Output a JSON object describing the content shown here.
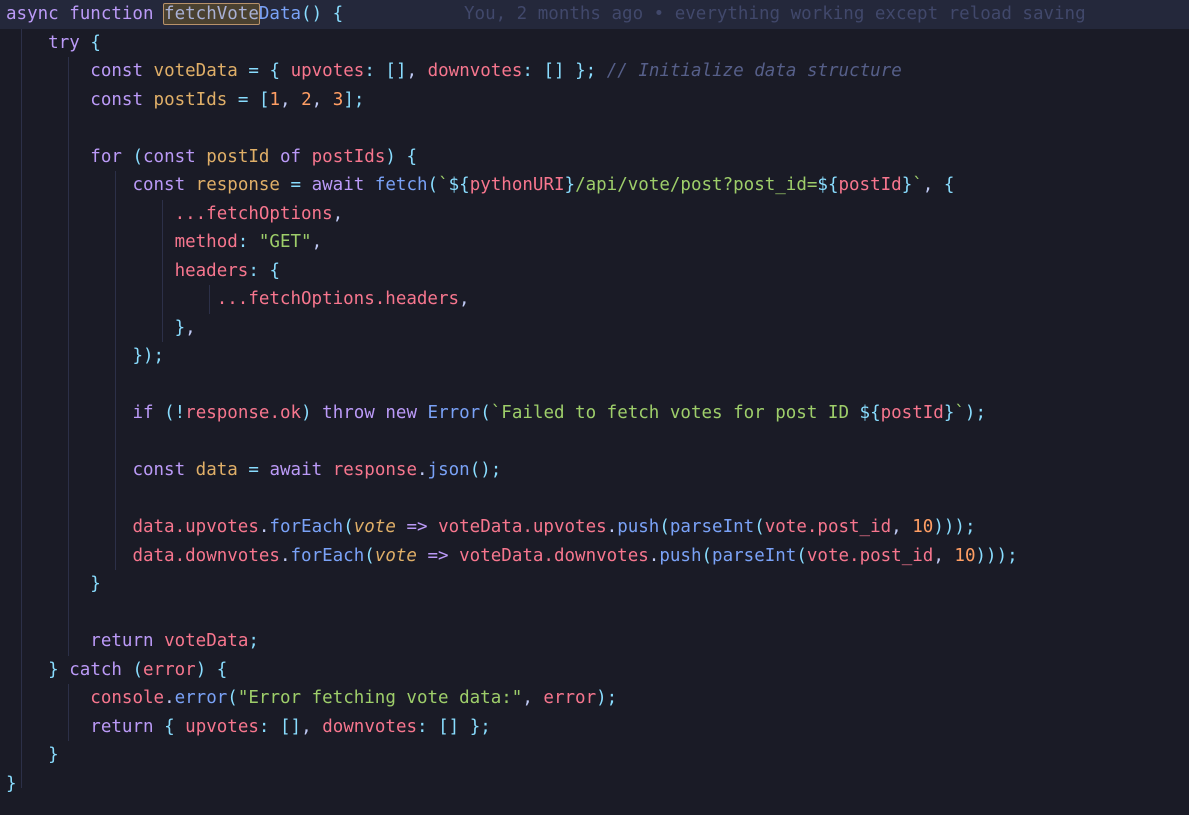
{
  "editor": {
    "background": "#1a1b26",
    "active_line_background": "#24283b",
    "font_size_px": 17.5,
    "line_height_px": 28.5,
    "indent_guide_color": "#2c3048"
  },
  "blame": {
    "text": "You, 2 months ago • everything working except reload saving",
    "color": "#41486b"
  },
  "find_match": {
    "text": "fetchVote",
    "border_color": "#b8926a",
    "background_color": "#4a4130"
  },
  "colors": {
    "keyword": "#bb9af7",
    "function": "#7aa2f7",
    "variable": "#e0af68",
    "property": "#f7768e",
    "string": "#9ece6a",
    "number": "#ff9e64",
    "operator": "#89ddff",
    "comment": "#565f89",
    "text": "#c0caf5"
  },
  "code": {
    "language": "javascript",
    "plain_text": "async function fetchVoteData() {\n    try {\n        const voteData = { upvotes: [], downvotes: [] }; // Initialize data structure\n        const postIds = [1, 2, 3];\n\n        for (const postId of postIds) {\n            const response = await fetch(`${pythonURI}/api/vote/post?post_id=${postId}`, {\n                ...fetchOptions,\n                method: \"GET\",\n                headers: {\n                    ...fetchOptions.headers,\n                },\n            });\n\n            if (!response.ok) throw new Error(`Failed to fetch votes for post ID ${postId}`);\n\n            const data = await response.json();\n\n            data.upvotes.forEach(vote => voteData.upvotes.push(parseInt(vote.post_id, 10)));\n            data.downvotes.forEach(vote => voteData.downvotes.push(parseInt(vote.post_id, 10)));\n        }\n\n        return voteData;\n    } catch (error) {\n        console.error(\"Error fetching vote data:\", error);\n        return { upvotes: [], downvotes: [] };\n    }\n}",
    "lines": [
      "async function fetchVoteData() {",
      "    try {",
      "        const voteData = { upvotes: [], downvotes: [] }; // Initialize data structure",
      "        const postIds = [1, 2, 3];",
      "",
      "        for (const postId of postIds) {",
      "            const response = await fetch(`${pythonURI}/api/vote/post?post_id=${postId}`, {",
      "                ...fetchOptions,",
      "                method: \"GET\",",
      "                headers: {",
      "                    ...fetchOptions.headers,",
      "                },",
      "            });",
      "",
      "            if (!response.ok) throw new Error(`Failed to fetch votes for post ID ${postId}`);",
      "",
      "            const data = await response.json();",
      "",
      "            data.upvotes.forEach(vote => voteData.upvotes.push(parseInt(vote.post_id, 10)));",
      "            data.downvotes.forEach(vote => voteData.downvotes.push(parseInt(vote.post_id, 10)));",
      "        }",
      "",
      "        return voteData;",
      "    } catch (error) {",
      "        console.error(\"Error fetching vote data:\", error);",
      "        return { upvotes: [], downvotes: [] };",
      "    }",
      "}"
    ]
  }
}
